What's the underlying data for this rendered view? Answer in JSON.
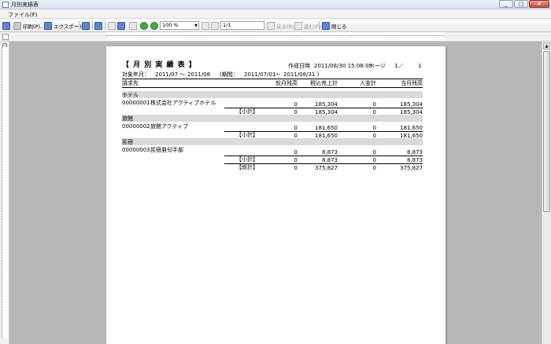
{
  "window": {
    "title": "月別実績表",
    "controls": [
      "_",
      "□",
      "×"
    ]
  },
  "menu": {
    "items": [
      "ファイル(F)"
    ]
  },
  "toolbar": {
    "print_label": "印刷(P)...",
    "export_label": "エクスポート",
    "zoom": "100 %",
    "page": "1/1",
    "back_label": "戻る(B)",
    "forward_label": "進む(F)",
    "close_label": "閉じる"
  },
  "report": {
    "title": "【 月 別 実 績 表 】",
    "created_label": "作成日時",
    "created_value": "2011/08/30 15:08:05",
    "page_label": "ページ",
    "page_value": "1／",
    "page_total": "1",
    "target_label": "対象年月：",
    "target_from": "2011/07",
    "tilde": "～",
    "target_to": "2011/08",
    "period_label": "(期間：",
    "period_from": "2011/07/01",
    "period_to": "2011/08/31 )",
    "columns": [
      "請求先",
      "前月残高",
      "税込売上計",
      "入金計",
      "当月残高"
    ],
    "groups": [
      {
        "name": "ホテル",
        "rows": [
          {
            "code": "00000001",
            "name": "株式会社アクティブホテル",
            "prev": "0",
            "sales": "185,304",
            "payments": "0",
            "balance": "185,304"
          }
        ],
        "subtotal": {
          "label": "【小計】",
          "prev": "0",
          "sales": "185,304",
          "payments": "0",
          "balance": "185,304"
        }
      },
      {
        "name": "旅館",
        "rows": [
          {
            "code": "00000002",
            "name": "旅館アクティブ",
            "prev": "0",
            "sales": "181,650",
            "payments": "0",
            "balance": "181,650"
          }
        ],
        "subtotal": {
          "label": "【小計】",
          "prev": "0",
          "sales": "181,650",
          "payments": "0",
          "balance": "181,650"
        }
      },
      {
        "name": "民宿",
        "rows": [
          {
            "code": "00000003",
            "name": "民宿亜句手部",
            "prev": "0",
            "sales": "8,873",
            "payments": "0",
            "balance": "8,873"
          }
        ],
        "subtotal": {
          "label": "【小計】",
          "prev": "0",
          "sales": "8,873",
          "payments": "0",
          "balance": "8,873"
        }
      }
    ],
    "total": {
      "label": "【総計】",
      "prev": "0",
      "sales": "375,827",
      "payments": "0",
      "balance": "375,827"
    }
  }
}
